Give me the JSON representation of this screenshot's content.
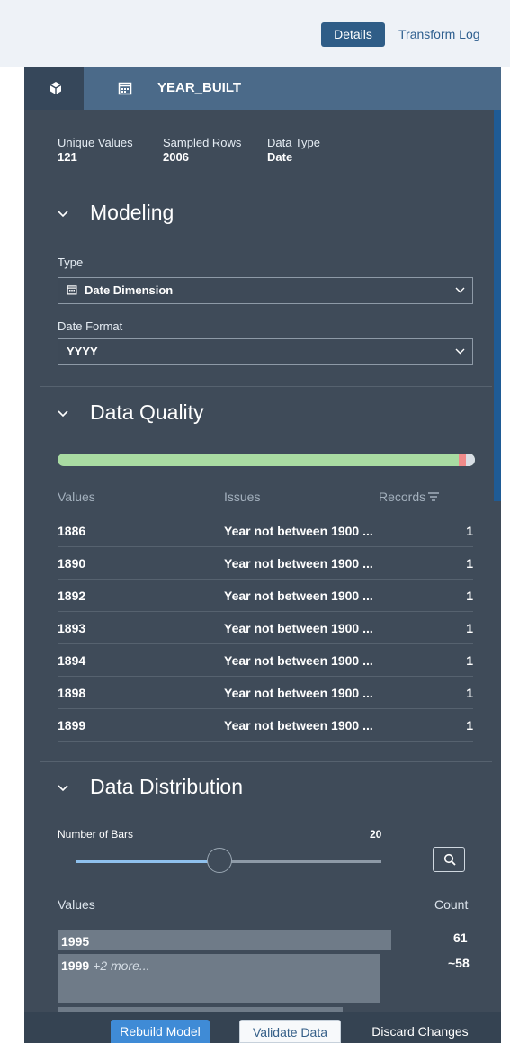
{
  "top_tabs": {
    "details": "Details",
    "transform_log": "Transform Log"
  },
  "header": {
    "title": "YEAR_BUILT",
    "icons": [
      "cube-icon",
      "calendar-icon"
    ]
  },
  "stats": [
    {
      "label": "Unique Values",
      "value": "121"
    },
    {
      "label": "Sampled Rows",
      "value": "2006"
    },
    {
      "label": "Data Type",
      "value": "Date"
    }
  ],
  "modeling": {
    "title": "Modeling",
    "type_label": "Type",
    "type_value": "Date Dimension",
    "format_label": "Date Format",
    "format_value": "YYYY"
  },
  "quality": {
    "title": "Data Quality",
    "columns": {
      "values": "Values",
      "issues": "Issues",
      "records": "Records"
    },
    "rows": [
      {
        "value": "1886",
        "issue": "Year not between 1900 ...",
        "records": "1"
      },
      {
        "value": "1890",
        "issue": "Year not between 1900 ...",
        "records": "1"
      },
      {
        "value": "1892",
        "issue": "Year not between 1900 ...",
        "records": "1"
      },
      {
        "value": "1893",
        "issue": "Year not between 1900 ...",
        "records": "1"
      },
      {
        "value": "1894",
        "issue": "Year not between 1900 ...",
        "records": "1"
      },
      {
        "value": "1898",
        "issue": "Year not between 1900 ...",
        "records": "1"
      },
      {
        "value": "1899",
        "issue": "Year not between 1900 ...",
        "records": "1"
      }
    ]
  },
  "distribution": {
    "title": "Data Distribution",
    "bars_label": "Number of Bars",
    "bars_value": "20",
    "slider_fraction": 0.47,
    "columns": {
      "values": "Values",
      "count": "Count"
    },
    "rows": [
      {
        "value": "1995",
        "more": "",
        "count": "61"
      },
      {
        "value": "1999",
        "more": "+2 more...",
        "count": "~58"
      }
    ]
  },
  "footer": {
    "rebuild": "Rebuild Model",
    "validate": "Validate Data",
    "discard": "Discard Changes"
  },
  "colors": {
    "panel": "#3f4b59",
    "header": "#4b6a89",
    "accent": "#3f8bd6",
    "quality_good": "#a9dba2",
    "quality_bad": "#ef8a8a"
  }
}
